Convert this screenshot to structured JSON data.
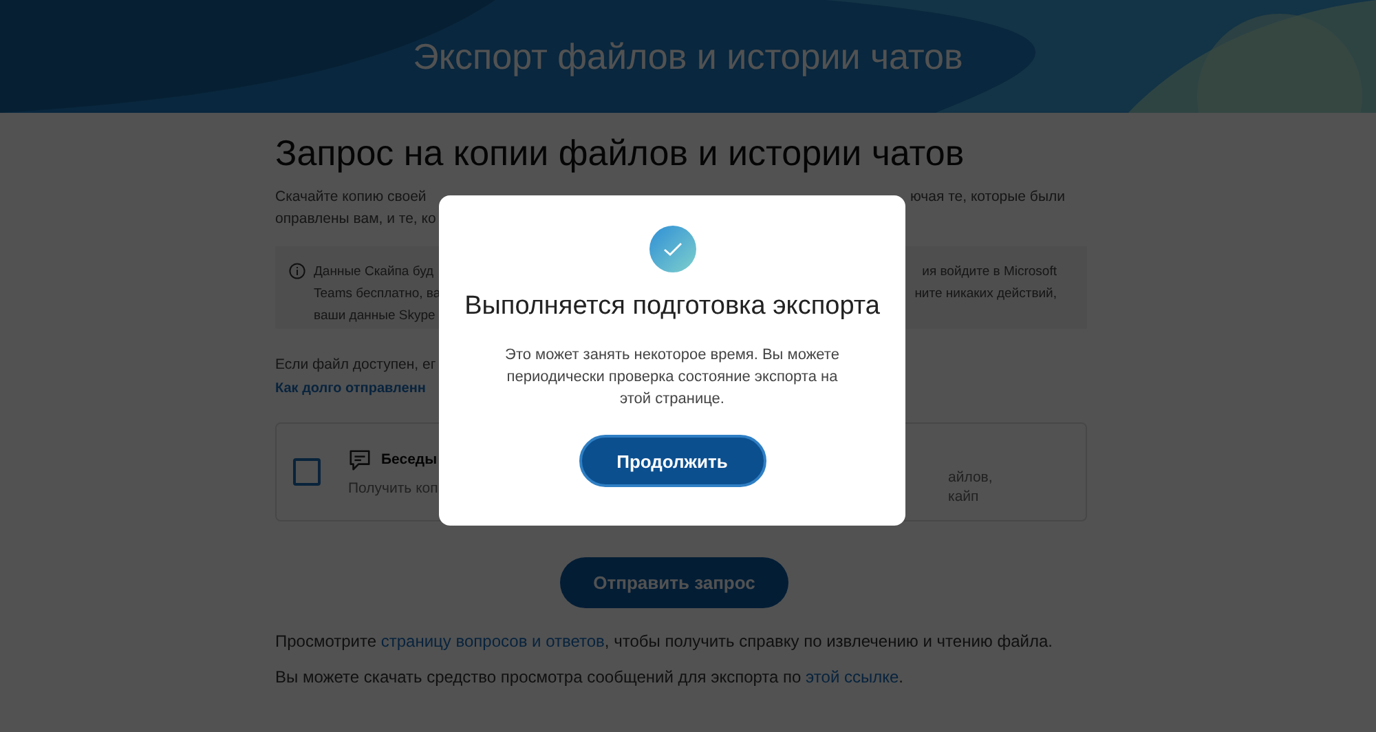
{
  "header": {
    "title": "Экспорт файлов и истории чатов"
  },
  "page": {
    "heading": "Запрос на копии файлов и истории чатов",
    "intro_lines": [
      {
        "left": "Скачайте копию своей",
        "right": "ючая те, которые были"
      },
      {
        "left": "оправлены вам, и те, ко"
      }
    ],
    "notice": {
      "lines": [
        {
          "left": "Данные Скайпа буд",
          "right": "ия войдите в Microsoft"
        },
        {
          "left": "Teams бесплатно, ва",
          "right": "ните никаких действий,"
        },
        {
          "left": "ваши данные Skype"
        }
      ]
    },
    "availability": {
      "text": "Если файл доступен, ег",
      "link": "Как долго отправленн"
    },
    "options": [
      {
        "title": "Беседы",
        "description": "Получить коп",
        "checked": false,
        "right_lines": [
          "айлов,",
          "кайп"
        ]
      }
    ],
    "submit_button": "Отправить запрос",
    "footer_lines": [
      {
        "before": "Просмотрите ",
        "link": "страницу вопросов и ответов",
        "after": ", чтобы получить справку по извлечению и чтению файла."
      },
      {
        "before": "Вы можете скачать средство просмотра сообщений для экспорта по ",
        "link": "этой ссылке",
        "after": "."
      }
    ]
  },
  "dialog": {
    "title": "Выполняется подготовка экспорта",
    "message": "Это может занять некоторое время. Вы можете периодически проверка состояние экспорта на этой странице.",
    "button": "Продолжить"
  }
}
